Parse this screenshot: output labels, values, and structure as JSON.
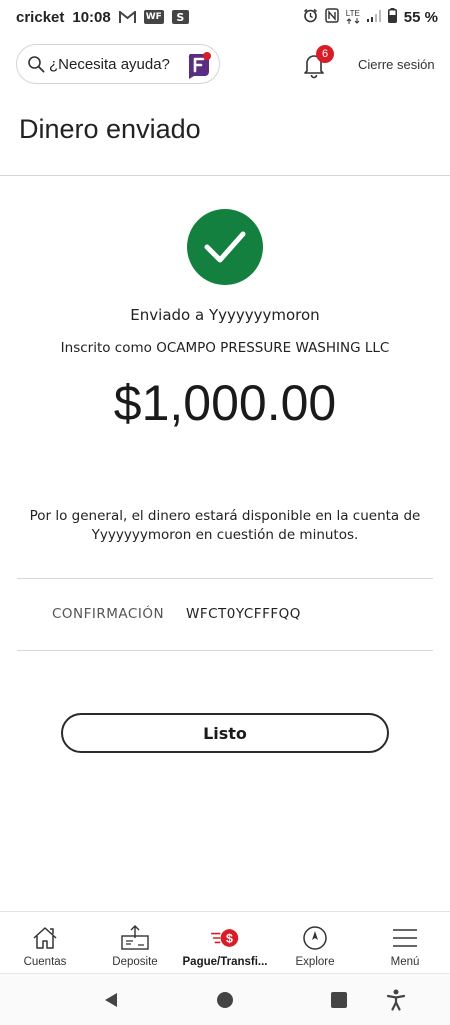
{
  "status_bar": {
    "carrier": "cricket",
    "time": "10:08",
    "notif_icons": [
      "gmail-icon",
      "wf-icon",
      "s-icon"
    ],
    "wf_label": "WF",
    "s_label": "S",
    "lte_label": "LTE",
    "battery": "55 %"
  },
  "header": {
    "search_placeholder": "¿Necesita ayuda?",
    "notification_count": "6",
    "logout_label": "Cierre sesión"
  },
  "page": {
    "title": "Dinero enviado",
    "sent_to": "Enviado a Yyyyyyymoron",
    "enrolled_as": "Inscrito como OCAMPO PRESSURE WASHING LLC",
    "amount": "$1,000.00",
    "availability_line1": "Por lo general, el dinero estará disponible en la cuenta de",
    "availability_line2": "Yyyyyyymoron en cuestión de minutos.",
    "confirmation_label": "CONFIRMACIÓN",
    "confirmation_value": "WFCT0YCFFFQQ",
    "done_label": "Listo"
  },
  "colors": {
    "success_green": "#148040",
    "brand_red": "#d71e28",
    "fargo_purple": "#5a2d82"
  },
  "bottom_nav": {
    "items": [
      {
        "label": "Cuentas",
        "icon": "home-icon"
      },
      {
        "label": "Deposite",
        "icon": "deposit-icon"
      },
      {
        "label": "Pague/Transfi...",
        "icon": "pay-transfer-icon"
      },
      {
        "label": "Explore",
        "icon": "compass-icon"
      },
      {
        "label": "Menú",
        "icon": "menu-icon"
      }
    ],
    "active_index": 2
  }
}
